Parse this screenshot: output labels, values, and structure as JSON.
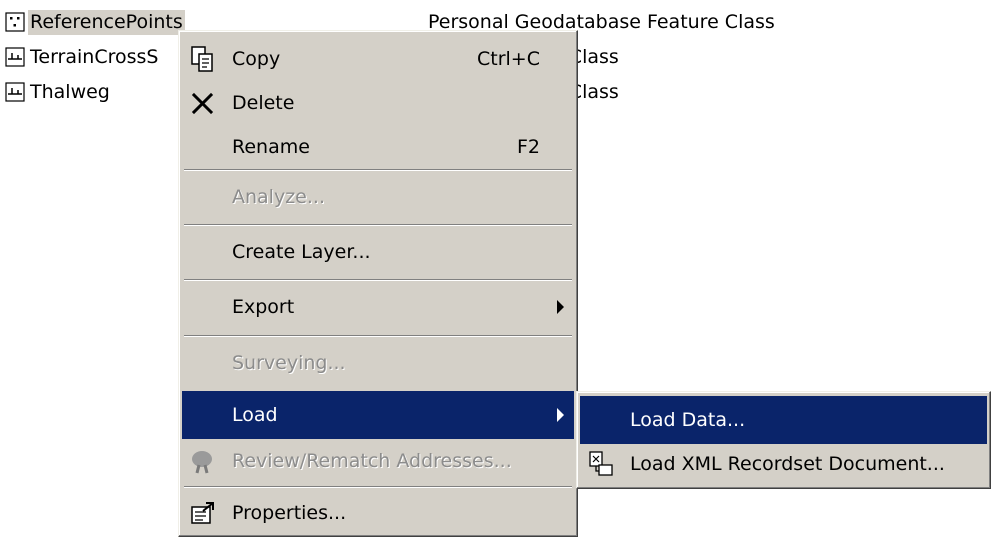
{
  "list": [
    {
      "name": "ReferencePoints",
      "type": "Personal Geodatabase Feature Class",
      "icon": "point-feature-class-icon",
      "selected": true
    },
    {
      "name": "TerrainCrossS",
      "type": "abase Feature Class",
      "icon": "line-feature-class-icon",
      "selected": false
    },
    {
      "name": "Thalweg",
      "type": "abase Feature Class",
      "icon": "line-feature-class-icon",
      "selected": false
    }
  ],
  "context_menu": {
    "copy": {
      "label": "Copy",
      "shortcut": "Ctrl+C"
    },
    "delete": {
      "label": "Delete"
    },
    "rename": {
      "label": "Rename",
      "shortcut": "F2"
    },
    "analyze": {
      "label": "Analyze..."
    },
    "create_layer": {
      "label": "Create Layer..."
    },
    "export": {
      "label": "Export"
    },
    "surveying": {
      "label": "Surveying..."
    },
    "load": {
      "label": "Load"
    },
    "review": {
      "label": "Review/Rematch Addresses..."
    },
    "properties": {
      "label": "Properties..."
    }
  },
  "submenu": {
    "load_data": {
      "label": "Load Data..."
    },
    "load_xml": {
      "label": "Load XML Recordset Document..."
    }
  },
  "colors": {
    "highlight": "#0a246a",
    "menu_bg": "#d4d0c8",
    "disabled_text": "#8c8c8c"
  }
}
